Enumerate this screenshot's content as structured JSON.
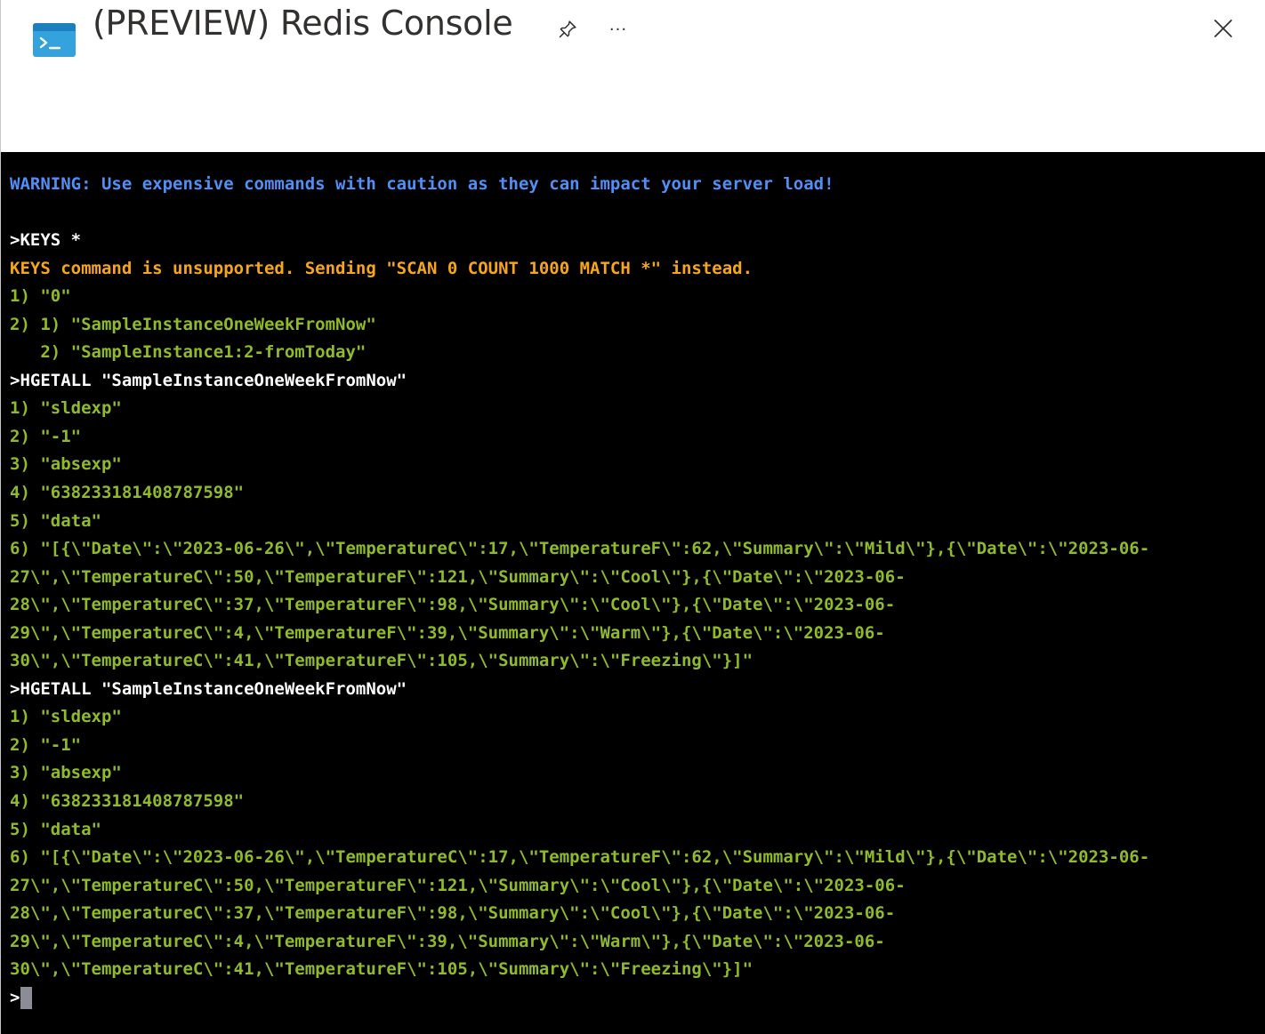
{
  "window": {
    "title": "(PREVIEW) Redis Console",
    "pin_icon": "pin-icon",
    "more_label": "···",
    "close_icon": "close-icon",
    "app_icon": "console-icon"
  },
  "colors": {
    "warning": "#4f8ff7",
    "command": "#ffffff",
    "notice": "#f7a51c",
    "output": "#8fba2a",
    "background": "#000000",
    "caret": "#8a8d96",
    "app_icon_blue": "#34a3dd"
  },
  "console": {
    "lines": [
      {
        "type": "warning",
        "text": "WARNING: Use expensive commands with caution as they can impact your server load!"
      },
      {
        "type": "blank",
        "text": ""
      },
      {
        "type": "command",
        "text": ">KEYS *"
      },
      {
        "type": "notice",
        "text": "KEYS command is unsupported. Sending \"SCAN 0 COUNT 1000 MATCH *\" instead."
      },
      {
        "type": "output",
        "text": "1) \"0\""
      },
      {
        "type": "output",
        "text": "2) 1) \"SampleInstanceOneWeekFromNow\""
      },
      {
        "type": "output",
        "text": "   2) \"SampleInstance1:2-fromToday\""
      },
      {
        "type": "command",
        "text": ">HGETALL \"SampleInstanceOneWeekFromNow\""
      },
      {
        "type": "output",
        "text": "1) \"sldexp\""
      },
      {
        "type": "output",
        "text": "2) \"-1\""
      },
      {
        "type": "output",
        "text": "3) \"absexp\""
      },
      {
        "type": "output",
        "text": "4) \"638233181408787598\""
      },
      {
        "type": "output",
        "text": "5) \"data\""
      },
      {
        "type": "output",
        "text": "6) \"[{\\\"Date\\\":\\\"2023-06-26\\\",\\\"TemperatureC\\\":17,\\\"TemperatureF\\\":62,\\\"Summary\\\":\\\"Mild\\\"},{\\\"Date\\\":\\\"2023-06-"
      },
      {
        "type": "output",
        "text": "27\\\",\\\"TemperatureC\\\":50,\\\"TemperatureF\\\":121,\\\"Summary\\\":\\\"Cool\\\"},{\\\"Date\\\":\\\"2023-06-"
      },
      {
        "type": "output",
        "text": "28\\\",\\\"TemperatureC\\\":37,\\\"TemperatureF\\\":98,\\\"Summary\\\":\\\"Cool\\\"},{\\\"Date\\\":\\\"2023-06-"
      },
      {
        "type": "output",
        "text": "29\\\",\\\"TemperatureC\\\":4,\\\"TemperatureF\\\":39,\\\"Summary\\\":\\\"Warm\\\"},{\\\"Date\\\":\\\"2023-06-"
      },
      {
        "type": "output",
        "text": "30\\\",\\\"TemperatureC\\\":41,\\\"TemperatureF\\\":105,\\\"Summary\\\":\\\"Freezing\\\"}]\""
      },
      {
        "type": "command",
        "text": ">HGETALL \"SampleInstanceOneWeekFromNow\""
      },
      {
        "type": "output",
        "text": "1) \"sldexp\""
      },
      {
        "type": "output",
        "text": "2) \"-1\""
      },
      {
        "type": "output",
        "text": "3) \"absexp\""
      },
      {
        "type": "output",
        "text": "4) \"638233181408787598\""
      },
      {
        "type": "output",
        "text": "5) \"data\""
      },
      {
        "type": "output",
        "text": "6) \"[{\\\"Date\\\":\\\"2023-06-26\\\",\\\"TemperatureC\\\":17,\\\"TemperatureF\\\":62,\\\"Summary\\\":\\\"Mild\\\"},{\\\"Date\\\":\\\"2023-06-"
      },
      {
        "type": "output",
        "text": "27\\\",\\\"TemperatureC\\\":50,\\\"TemperatureF\\\":121,\\\"Summary\\\":\\\"Cool\\\"},{\\\"Date\\\":\\\"2023-06-"
      },
      {
        "type": "output",
        "text": "28\\\",\\\"TemperatureC\\\":37,\\\"TemperatureF\\\":98,\\\"Summary\\\":\\\"Cool\\\"},{\\\"Date\\\":\\\"2023-06-"
      },
      {
        "type": "output",
        "text": "29\\\",\\\"TemperatureC\\\":4,\\\"TemperatureF\\\":39,\\\"Summary\\\":\\\"Warm\\\"},{\\\"Date\\\":\\\"2023-06-"
      },
      {
        "type": "output",
        "text": "30\\\",\\\"TemperatureC\\\":41,\\\"TemperatureF\\\":105,\\\"Summary\\\":\\\"Freezing\\\"}]\""
      }
    ],
    "prompt": ">",
    "input_value": ""
  }
}
